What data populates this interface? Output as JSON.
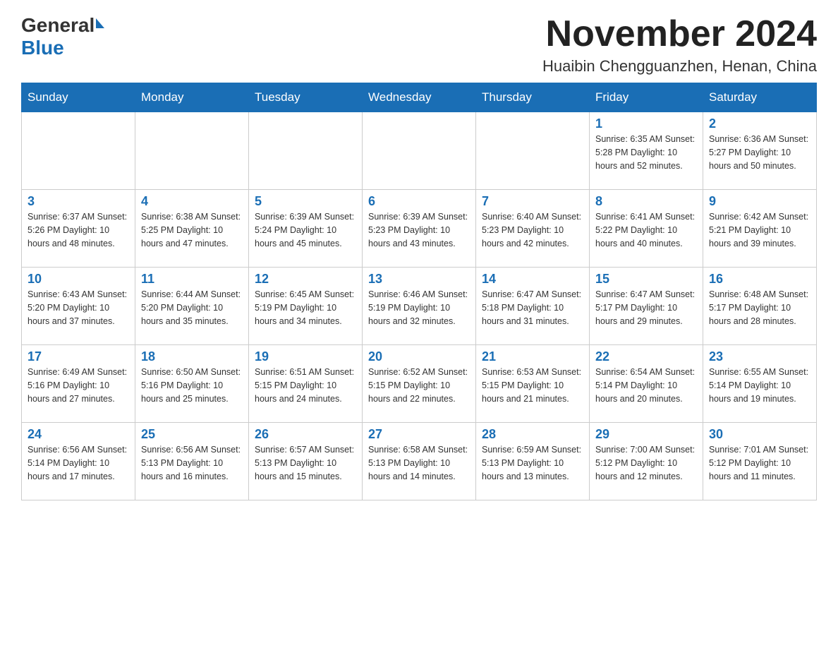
{
  "header": {
    "logo_general": "General",
    "logo_blue": "Blue",
    "main_title": "November 2024",
    "subtitle": "Huaibin Chengguanzhen, Henan, China"
  },
  "weekdays": [
    "Sunday",
    "Monday",
    "Tuesday",
    "Wednesday",
    "Thursday",
    "Friday",
    "Saturday"
  ],
  "weeks": [
    [
      {
        "day": "",
        "info": ""
      },
      {
        "day": "",
        "info": ""
      },
      {
        "day": "",
        "info": ""
      },
      {
        "day": "",
        "info": ""
      },
      {
        "day": "",
        "info": ""
      },
      {
        "day": "1",
        "info": "Sunrise: 6:35 AM\nSunset: 5:28 PM\nDaylight: 10 hours and 52 minutes."
      },
      {
        "day": "2",
        "info": "Sunrise: 6:36 AM\nSunset: 5:27 PM\nDaylight: 10 hours and 50 minutes."
      }
    ],
    [
      {
        "day": "3",
        "info": "Sunrise: 6:37 AM\nSunset: 5:26 PM\nDaylight: 10 hours and 48 minutes."
      },
      {
        "day": "4",
        "info": "Sunrise: 6:38 AM\nSunset: 5:25 PM\nDaylight: 10 hours and 47 minutes."
      },
      {
        "day": "5",
        "info": "Sunrise: 6:39 AM\nSunset: 5:24 PM\nDaylight: 10 hours and 45 minutes."
      },
      {
        "day": "6",
        "info": "Sunrise: 6:39 AM\nSunset: 5:23 PM\nDaylight: 10 hours and 43 minutes."
      },
      {
        "day": "7",
        "info": "Sunrise: 6:40 AM\nSunset: 5:23 PM\nDaylight: 10 hours and 42 minutes."
      },
      {
        "day": "8",
        "info": "Sunrise: 6:41 AM\nSunset: 5:22 PM\nDaylight: 10 hours and 40 minutes."
      },
      {
        "day": "9",
        "info": "Sunrise: 6:42 AM\nSunset: 5:21 PM\nDaylight: 10 hours and 39 minutes."
      }
    ],
    [
      {
        "day": "10",
        "info": "Sunrise: 6:43 AM\nSunset: 5:20 PM\nDaylight: 10 hours and 37 minutes."
      },
      {
        "day": "11",
        "info": "Sunrise: 6:44 AM\nSunset: 5:20 PM\nDaylight: 10 hours and 35 minutes."
      },
      {
        "day": "12",
        "info": "Sunrise: 6:45 AM\nSunset: 5:19 PM\nDaylight: 10 hours and 34 minutes."
      },
      {
        "day": "13",
        "info": "Sunrise: 6:46 AM\nSunset: 5:19 PM\nDaylight: 10 hours and 32 minutes."
      },
      {
        "day": "14",
        "info": "Sunrise: 6:47 AM\nSunset: 5:18 PM\nDaylight: 10 hours and 31 minutes."
      },
      {
        "day": "15",
        "info": "Sunrise: 6:47 AM\nSunset: 5:17 PM\nDaylight: 10 hours and 29 minutes."
      },
      {
        "day": "16",
        "info": "Sunrise: 6:48 AM\nSunset: 5:17 PM\nDaylight: 10 hours and 28 minutes."
      }
    ],
    [
      {
        "day": "17",
        "info": "Sunrise: 6:49 AM\nSunset: 5:16 PM\nDaylight: 10 hours and 27 minutes."
      },
      {
        "day": "18",
        "info": "Sunrise: 6:50 AM\nSunset: 5:16 PM\nDaylight: 10 hours and 25 minutes."
      },
      {
        "day": "19",
        "info": "Sunrise: 6:51 AM\nSunset: 5:15 PM\nDaylight: 10 hours and 24 minutes."
      },
      {
        "day": "20",
        "info": "Sunrise: 6:52 AM\nSunset: 5:15 PM\nDaylight: 10 hours and 22 minutes."
      },
      {
        "day": "21",
        "info": "Sunrise: 6:53 AM\nSunset: 5:15 PM\nDaylight: 10 hours and 21 minutes."
      },
      {
        "day": "22",
        "info": "Sunrise: 6:54 AM\nSunset: 5:14 PM\nDaylight: 10 hours and 20 minutes."
      },
      {
        "day": "23",
        "info": "Sunrise: 6:55 AM\nSunset: 5:14 PM\nDaylight: 10 hours and 19 minutes."
      }
    ],
    [
      {
        "day": "24",
        "info": "Sunrise: 6:56 AM\nSunset: 5:14 PM\nDaylight: 10 hours and 17 minutes."
      },
      {
        "day": "25",
        "info": "Sunrise: 6:56 AM\nSunset: 5:13 PM\nDaylight: 10 hours and 16 minutes."
      },
      {
        "day": "26",
        "info": "Sunrise: 6:57 AM\nSunset: 5:13 PM\nDaylight: 10 hours and 15 minutes."
      },
      {
        "day": "27",
        "info": "Sunrise: 6:58 AM\nSunset: 5:13 PM\nDaylight: 10 hours and 14 minutes."
      },
      {
        "day": "28",
        "info": "Sunrise: 6:59 AM\nSunset: 5:13 PM\nDaylight: 10 hours and 13 minutes."
      },
      {
        "day": "29",
        "info": "Sunrise: 7:00 AM\nSunset: 5:12 PM\nDaylight: 10 hours and 12 minutes."
      },
      {
        "day": "30",
        "info": "Sunrise: 7:01 AM\nSunset: 5:12 PM\nDaylight: 10 hours and 11 minutes."
      }
    ]
  ]
}
